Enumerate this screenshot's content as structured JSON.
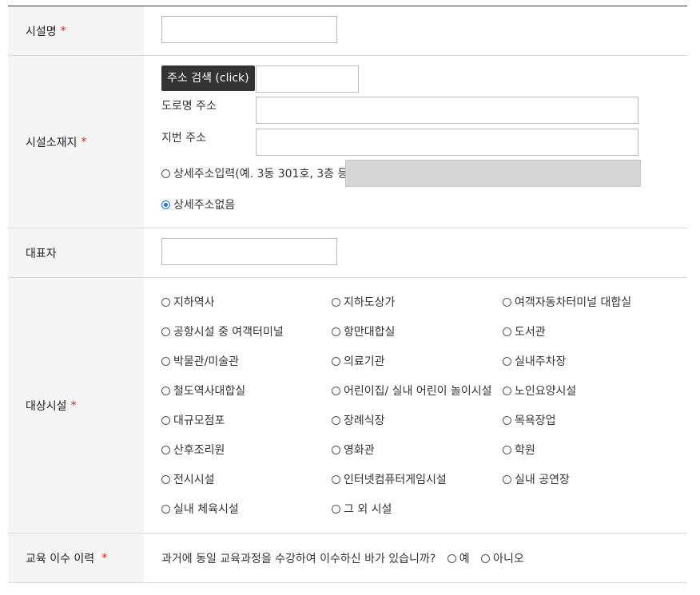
{
  "required_mark": "*",
  "rows": {
    "facility_name": {
      "label": "시설명"
    },
    "facility_location": {
      "label": "시설소재지",
      "search_button": "주소 검색 (click)",
      "road_label": "도로명 주소",
      "lot_label": "지번 주소",
      "detail_input_option": "상세주소입력(예. 3동 301호, 3층 등)",
      "no_detail_option": "상세주소없음"
    },
    "representative": {
      "label": "대표자"
    },
    "target_facility": {
      "label": "대상시설",
      "options": [
        "지하역사",
        "지하도상가",
        "여객자동차터미널 대합실",
        "공항시설 중 여객터미널",
        "항만대합실",
        "도서관",
        "박물관/미술관",
        "의료기관",
        "실내주차장",
        "철도역사대합실",
        "어린이집/ 실내 어린이 놀이시설",
        "노인요양시설",
        "대규모점포",
        "장례식장",
        "목욕장업",
        "산후조리원",
        "영화관",
        "학원",
        "전시시설",
        "인터넷컴퓨터게임시설",
        "실내 공연장",
        "실내 체육시설",
        "그 외 시설"
      ]
    },
    "education_history": {
      "label": "교육 이수 이력",
      "question": "과거에 동일 교육과정을 수강하여 이수하신 바가 있습니까?",
      "yes": "예",
      "no": "아니오"
    }
  }
}
